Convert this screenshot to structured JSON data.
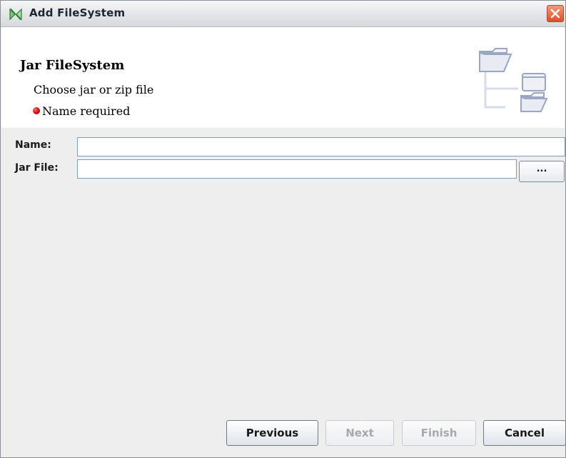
{
  "window": {
    "title": "Add FileSystem",
    "icons": {
      "app": "netbeans-app-icon",
      "close": "close-icon"
    },
    "colors": {
      "close_button": "#d8502b",
      "error_indicator": "#cc0000",
      "field_border": "#7f9db9"
    }
  },
  "banner": {
    "title": "Jar FileSystem",
    "subtitle": "Choose jar or zip file",
    "error_text": "Name required",
    "icon": "filesystem-tree-icon"
  },
  "form": {
    "name_label": "Name:",
    "name_value": "",
    "jar_label": "Jar File:",
    "jar_value": "",
    "browse_label": "..."
  },
  "buttons": {
    "previous": "Previous",
    "next": "Next",
    "finish": "Finish",
    "cancel": "Cancel"
  }
}
